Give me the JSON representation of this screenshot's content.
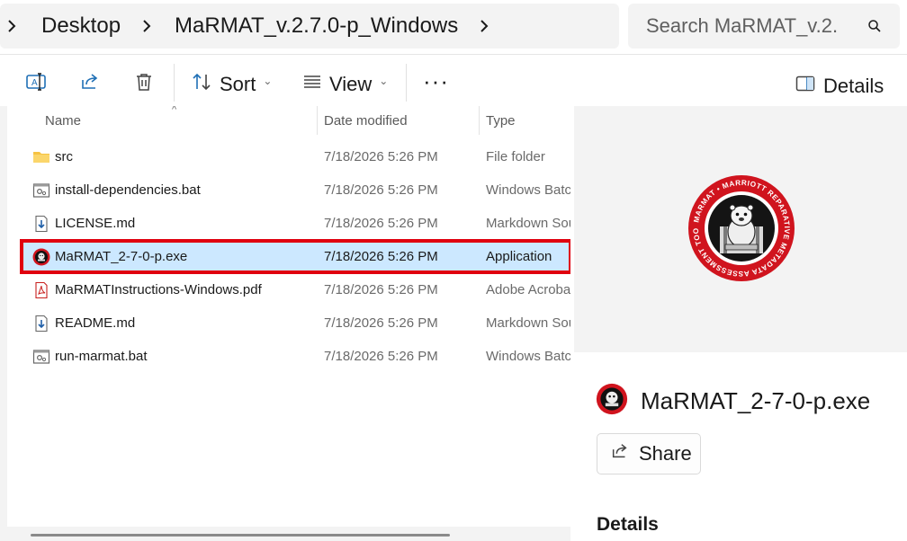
{
  "address_bar": {
    "crumbs": [
      "Desktop",
      "MaRMAT_v.2.7.0-p_Windows"
    ],
    "search_placeholder": "Search MaRMAT_v.2."
  },
  "command_bar": {
    "sort_label": "Sort",
    "view_label": "View",
    "more_label": "···",
    "details_label": "Details"
  },
  "columns": {
    "name": "Name",
    "date": "Date modified",
    "type": "Type"
  },
  "files": [
    {
      "name": "src",
      "date": "7/18/2026 5:26 PM",
      "type": "File folder",
      "icon": "folder-icon"
    },
    {
      "name": "install-dependencies.bat",
      "date": "7/18/2026 5:26 PM",
      "type": "Windows Batch File",
      "icon": "batch-file-icon"
    },
    {
      "name": "LICENSE.md",
      "date": "7/18/2026 5:26 PM",
      "type": "Markdown Source File",
      "icon": "markdown-file-icon"
    },
    {
      "name": "MaRMAT_2-7-0-p.exe",
      "date": "7/18/2026 5:26 PM",
      "type": "Application",
      "icon": "marmat-app-icon",
      "selected": true
    },
    {
      "name": "MaRMATInstructions-Windows.pdf",
      "date": "7/18/2026 5:26 PM",
      "type": "Adobe Acrobat Document",
      "icon": "pdf-file-icon"
    },
    {
      "name": "README.md",
      "date": "7/18/2026 5:26 PM",
      "type": "Markdown Source File",
      "icon": "markdown-file-icon"
    },
    {
      "name": "run-marmat.bat",
      "date": "7/18/2026 5:26 PM",
      "type": "Windows Batch File",
      "icon": "batch-file-icon"
    }
  ],
  "details_pane": {
    "file_name": "MaRMAT_2-7-0-p.exe",
    "share_label": "Share",
    "section_heading": "Details",
    "seal_text": "MARMAT • MARRIOTT REPARATIVE METADATA ASSESSMENT TOOL •"
  },
  "colors": {
    "selection_fill": "#cce8ff",
    "highlight_border": "#e0000f",
    "seal_red": "#d0141e",
    "folder_yellow": "#f6c343"
  }
}
